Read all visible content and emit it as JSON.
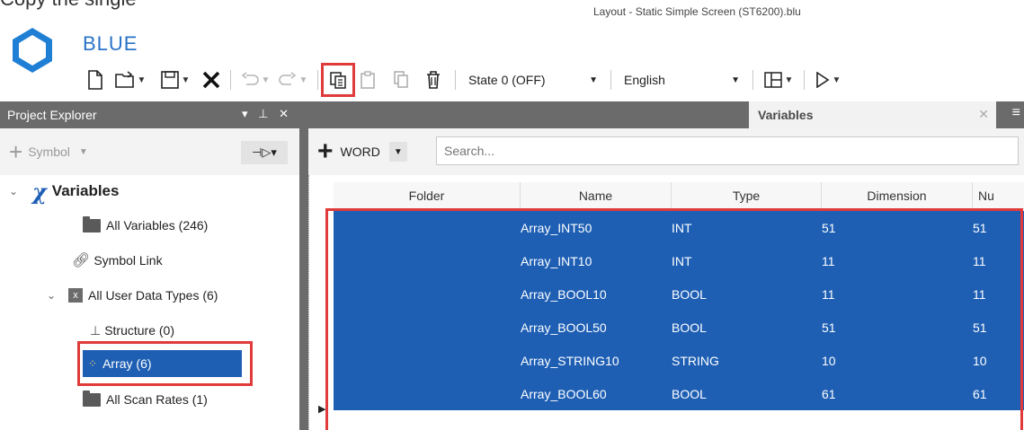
{
  "caption": "Copy the single",
  "window_title": "Layout - Static Simple Screen (ST6200).blu",
  "app_name": "BLUE",
  "toolbar": {
    "state_combo": "State 0 (OFF)",
    "language_combo": "English"
  },
  "project_explorer": {
    "title": "Project Explorer",
    "symbol_button": "Symbol",
    "tree": {
      "variables": "Variables",
      "all_variables": "All Variables (246)",
      "symbol_link": "Symbol Link",
      "all_user_data_types": "All User Data Types (6)",
      "structure": "Structure (0)",
      "array": "Array (6)",
      "all_scan_rates": "All Scan Rates (1)"
    }
  },
  "document": {
    "tab_label": "Variables",
    "add_type": "WORD",
    "search_placeholder": "Search..."
  },
  "grid": {
    "columns": [
      "Folder",
      "Name",
      "Type",
      "Dimension",
      "Nu"
    ],
    "rows": [
      {
        "folder": "",
        "name": "Array_INT50",
        "type": "INT",
        "dimension": "51",
        "nu": "51"
      },
      {
        "folder": "",
        "name": "Array_INT10",
        "type": "INT",
        "dimension": "11",
        "nu": "11"
      },
      {
        "folder": "",
        "name": "Array_BOOL10",
        "type": "BOOL",
        "dimension": "11",
        "nu": "11"
      },
      {
        "folder": "",
        "name": "Array_BOOL50",
        "type": "BOOL",
        "dimension": "51",
        "nu": "51"
      },
      {
        "folder": "",
        "name": "Array_STRING10",
        "type": "STRING",
        "dimension": "10",
        "nu": "10"
      },
      {
        "folder": "",
        "name": "Array_BOOL60",
        "type": "BOOL",
        "dimension": "61",
        "nu": "61"
      }
    ]
  },
  "colors": {
    "selection": "#1e5fb4",
    "highlight": "#e03a3a",
    "panel_header": "#6b6b6b",
    "brand": "#2a73c8"
  }
}
